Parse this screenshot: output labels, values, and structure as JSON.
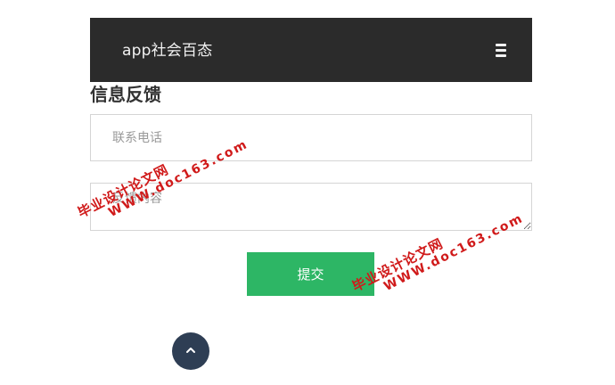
{
  "header": {
    "title": "app社会百态",
    "menu_icon": "hamburger-menu-icon"
  },
  "section": {
    "title": "信息反馈"
  },
  "form": {
    "phone_placeholder": "联系电话",
    "feedback_placeholder": "反馈内容",
    "submit_label": "提交"
  },
  "back_to_top": {
    "icon": "chevron-up-icon"
  },
  "watermarks": [
    {
      "cn": "毕业设计论文网",
      "url": "WWW.doc163.com"
    },
    {
      "cn": "毕业设计论文网",
      "url": "WWW.doc163.com"
    }
  ],
  "colors": {
    "header_bg": "#2b2b2b",
    "submit_bg": "#2db665",
    "back_top_bg": "#2e3e54",
    "watermark": "#d01a1a"
  }
}
